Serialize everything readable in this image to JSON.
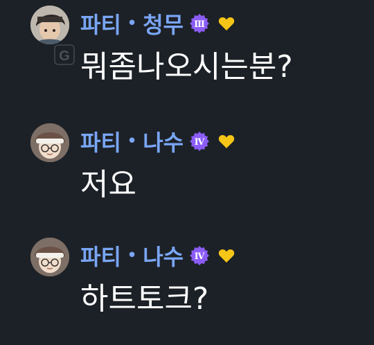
{
  "messages": [
    {
      "user": {
        "team": "파티",
        "separator": "•",
        "nickname": "청무",
        "rank": "Ⅲ",
        "avatar": "dark-haired-avatar",
        "has_badge": true,
        "badge": "G"
      },
      "text": "뭐좀나오시는분?"
    },
    {
      "user": {
        "team": "파티",
        "separator": "•",
        "nickname": "나수",
        "rank": "Ⅳ",
        "avatar": "headband-glasses-avatar",
        "has_badge": false
      },
      "text": "저요"
    },
    {
      "user": {
        "team": "파티",
        "separator": "•",
        "nickname": "나수",
        "rank": "Ⅳ",
        "avatar": "headband-glasses-avatar",
        "has_badge": false
      },
      "text": "하트토크?"
    }
  ],
  "colors": {
    "background": "#1c2127",
    "username": "#7aa6f6",
    "rank_badge": "#8b5cf6",
    "heart": "#f5c518",
    "message_text": "#ffffff"
  },
  "icons": {
    "rank_badge": "rank-badge-icon",
    "heart": "heart-icon",
    "g_badge": "g-badge-icon"
  }
}
